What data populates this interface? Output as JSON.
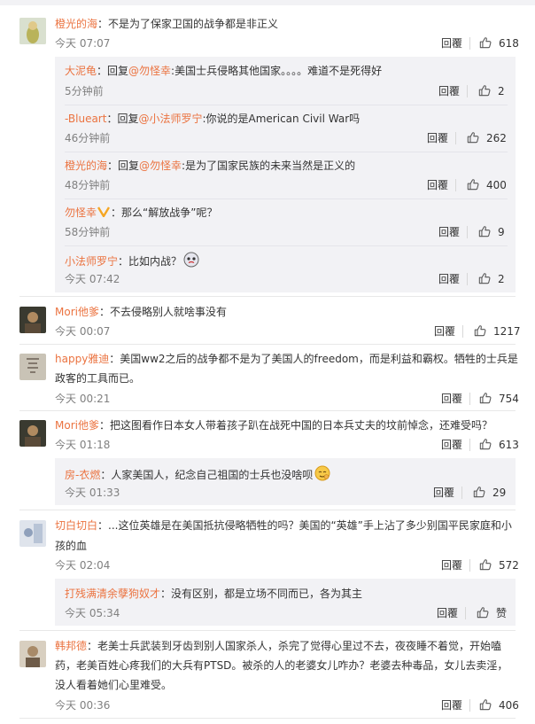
{
  "reply_label": "回覆",
  "colors": {
    "username": "#eb7340",
    "time": "#808080",
    "text": "#333333",
    "reply_box": "#f2f2f5"
  },
  "comments": [
    {
      "user": "橙光的海",
      "text": "：不是为了保家卫国的战争都是非正义",
      "time": "今天 07:07",
      "likes": "618",
      "replies": [
        {
          "user": "大泥龟",
          "prefix": "：回复",
          "mention": "@勿怪幸",
          "text": ":美国士兵侵略其他国家。。。。难道不是死得好",
          "time": "5分钟前",
          "likes": "2"
        },
        {
          "user": "-Blueart",
          "prefix": "：回复",
          "mention": "@小法师罗宁",
          "text": ":你说的是American Civil War吗",
          "time": "46分钟前",
          "likes": "262"
        },
        {
          "user": "橙光的海",
          "prefix": "：回复",
          "mention": "@勿怪幸",
          "text": ":是为了国家民族的未来当然是正义的",
          "time": "48分钟前",
          "likes": "400"
        },
        {
          "user": "勿怪幸",
          "prefix": "",
          "mention": "",
          "text": "：那么“解放战争”呢？",
          "time": "58分钟前",
          "likes": "9"
        },
        {
          "user": "小法师罗宁",
          "prefix": "",
          "mention": "",
          "text": "：比如内战？",
          "time": "今天 07:42",
          "likes": "2"
        }
      ]
    },
    {
      "user": "Mori他爹",
      "text": "：不去侵略别人就啥事没有",
      "time": "今天 00:07",
      "likes": "1217",
      "replies": []
    },
    {
      "user": "happy雅迪",
      "text": "：美国ww2之后的战争都不是为了美国人的freedom，而是利益和霸权。牺牲的士兵是",
      "text2": "政客的工具而已。",
      "time": "今天 00:21",
      "likes": "754",
      "replies": []
    },
    {
      "user": "Mori他爹",
      "text": "：把这图看作日本女人带着孩子趴在战死中国的日本兵丈夫的坟前悼念，还难受吗？",
      "time": "今天 01:18",
      "likes": "613",
      "replies": [
        {
          "user": "房-衣燃",
          "prefix": "",
          "mention": "",
          "text": "：人家美国人，纪念自己祖国的士兵也没啥呗",
          "time": "今天 01:33",
          "likes": "29"
        }
      ]
    },
    {
      "user": "切白切白",
      "text": "：...这位英雄是在美国抵抗侵略牺牲的吗？美国的“英雄”手上沾了多少别国平民家庭和小",
      "text2": "孩的血",
      "time": "今天 02:04",
      "likes": "572",
      "replies": [
        {
          "user": "打残满清余孽狗奴才",
          "prefix": "",
          "mention": "",
          "text": "：没有区别，都是立场不同而已，各为其主",
          "time": "今天 05:34",
          "likes": "赞"
        }
      ]
    },
    {
      "user": "韩邦德",
      "text": "：老美士兵武装到牙齿到别人国家杀人，杀完了觉得心里过不去，夜夜睡不着觉，开始嗑",
      "text2": "药，老美百姓心疼我们的大兵有PTSD。被杀的人的老婆女儿咋办？老婆去种毒品，女儿去卖淫，",
      "text3": "没人看着她们心里难受。",
      "time": "今天 00:36",
      "likes": "406",
      "replies": []
    }
  ]
}
